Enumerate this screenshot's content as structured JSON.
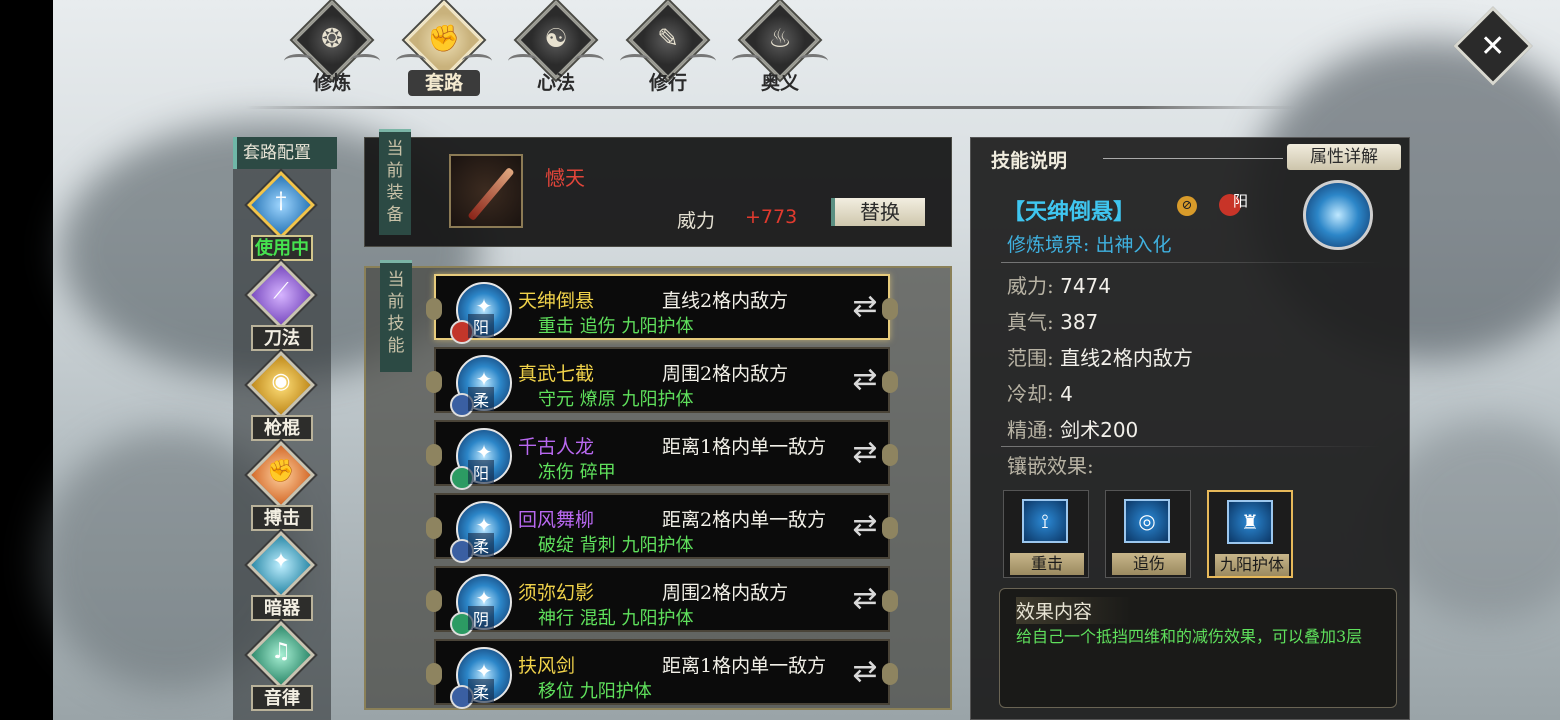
{
  "top_tabs": [
    {
      "label": "修炼",
      "icon": "swirl-icon",
      "active": false
    },
    {
      "label": "套路",
      "icon": "fist-icon",
      "active": true
    },
    {
      "label": "心法",
      "icon": "yin-yang-icon",
      "active": false
    },
    {
      "label": "修行",
      "icon": "scroll-icon",
      "active": false
    },
    {
      "label": "奥义",
      "icon": "flame-icon",
      "active": false
    }
  ],
  "sidebar": {
    "title": "套路配置",
    "routes": [
      {
        "name": "使用中",
        "icon": "sword-icon",
        "color": "#2b78b8",
        "active": true
      },
      {
        "name": "刀法",
        "icon": "blade-icon",
        "color": "#7a4cc0",
        "active": false
      },
      {
        "name": "枪棍",
        "icon": "spear-icon",
        "color": "#c08a1c",
        "active": false
      },
      {
        "name": "搏击",
        "icon": "fist-icon",
        "color": "#d46a2a",
        "active": false
      },
      {
        "name": "暗器",
        "icon": "dart-icon",
        "color": "#2c8aa8",
        "active": false
      },
      {
        "name": "音律",
        "icon": "music-icon",
        "color": "#2f8a6c",
        "active": false
      }
    ]
  },
  "equipment": {
    "tag": "当前装备",
    "weapon_name": "憾天",
    "power_label": "威力",
    "power_value": "+773",
    "replace_button": "替换"
  },
  "skills": {
    "tag": "当前技能",
    "rows": [
      {
        "name": "天绅倒悬",
        "name_color": "#f0d24a",
        "range": "直线2格内敌方",
        "effects": "重击  追伤  九阳护体",
        "attr": "阳",
        "badge": "red",
        "selected": true
      },
      {
        "name": "真武七截",
        "name_color": "#f0d24a",
        "range": "周围2格内敌方",
        "effects": "守元  燎原  九阳护体",
        "attr": "柔",
        "badge": "blue",
        "selected": false
      },
      {
        "name": "千古人龙",
        "name_color": "#b868f0",
        "range": "距离1格内单一敌方",
        "effects": "冻伤  碎甲",
        "attr": "阳",
        "badge": "green",
        "selected": false
      },
      {
        "name": "回风舞柳",
        "name_color": "#b868f0",
        "range": "距离2格内单一敌方",
        "effects": "破绽  背刺  九阳护体",
        "attr": "柔",
        "badge": "blue",
        "selected": false
      },
      {
        "name": "须弥幻影",
        "name_color": "#f0d24a",
        "range": "周围2格内敌方",
        "effects": "神行  混乱  九阳护体",
        "attr": "阴",
        "badge": "green",
        "selected": false
      },
      {
        "name": "扶风剑",
        "name_color": "#f0d24a",
        "range": "距离1格内单一敌方",
        "effects": "移位  九阳护体",
        "attr": "柔",
        "badge": "blue",
        "selected": false
      }
    ]
  },
  "detail": {
    "title": "技能说明",
    "attr_button": "属性详解",
    "skill_title": "【天绅倒悬】",
    "yang": "阳",
    "realm": "修炼境界: 出神入化",
    "stats": [
      {
        "k": "威力: ",
        "v": "7474"
      },
      {
        "k": "真气: ",
        "v": "387"
      },
      {
        "k": "范围: ",
        "v": "直线2格内敌方"
      },
      {
        "k": "冷却: ",
        "v": "4"
      },
      {
        "k": "精通: ",
        "v": "剑术200"
      }
    ],
    "inlay_label": "镶嵌效果:",
    "inlays": [
      {
        "name": "重击",
        "icon": "heavy-strike-icon",
        "selected": false
      },
      {
        "name": "追伤",
        "icon": "chase-damage-icon",
        "selected": false
      },
      {
        "name": "九阳护体",
        "icon": "nine-yang-shield-icon",
        "selected": true
      }
    ],
    "effect_title": "效果内容",
    "effect_text": "给自己一个抵挡四维和的减伤效果，可以叠加3层"
  }
}
